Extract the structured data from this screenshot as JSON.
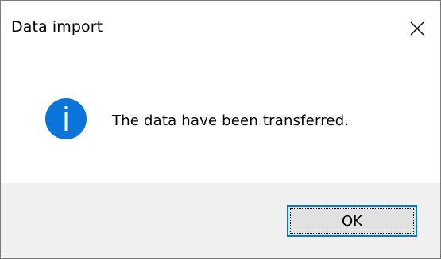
{
  "dialog": {
    "title": "Data import",
    "message": "The data have been transferred.",
    "icon": "info-icon",
    "ok_label": "OK",
    "close_icon": "close-icon"
  },
  "colors": {
    "icon_blue": "#0a74d8",
    "button_border": "#0078d7",
    "footer_bg": "#f0f0f0",
    "button_bg": "#e1e1e1"
  }
}
